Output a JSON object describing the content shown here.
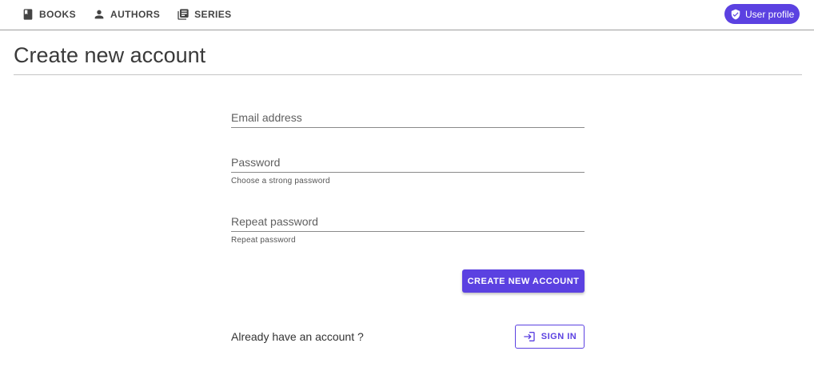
{
  "nav": {
    "items": [
      {
        "label": "BOOKS",
        "icon": "book-icon"
      },
      {
        "label": "AUTHORS",
        "icon": "person-icon"
      },
      {
        "label": "SERIES",
        "icon": "library-icon"
      }
    ],
    "profile_label": "User profile",
    "profile_icon": "shield-check-icon"
  },
  "page": {
    "title": "Create new account"
  },
  "form": {
    "email": {
      "placeholder": "Email address",
      "value": ""
    },
    "password": {
      "placeholder": "Password",
      "value": "",
      "hint": "Choose a strong password"
    },
    "repeat_password": {
      "placeholder": "Repeat password",
      "value": "",
      "hint": "Repeat password"
    },
    "create_label": "CREATE NEW ACCOUNT",
    "already_text": "Already have an account ?",
    "signin_label": "SIGN IN",
    "signin_icon": "login-icon"
  },
  "colors": {
    "accent": "#5b41e1"
  }
}
